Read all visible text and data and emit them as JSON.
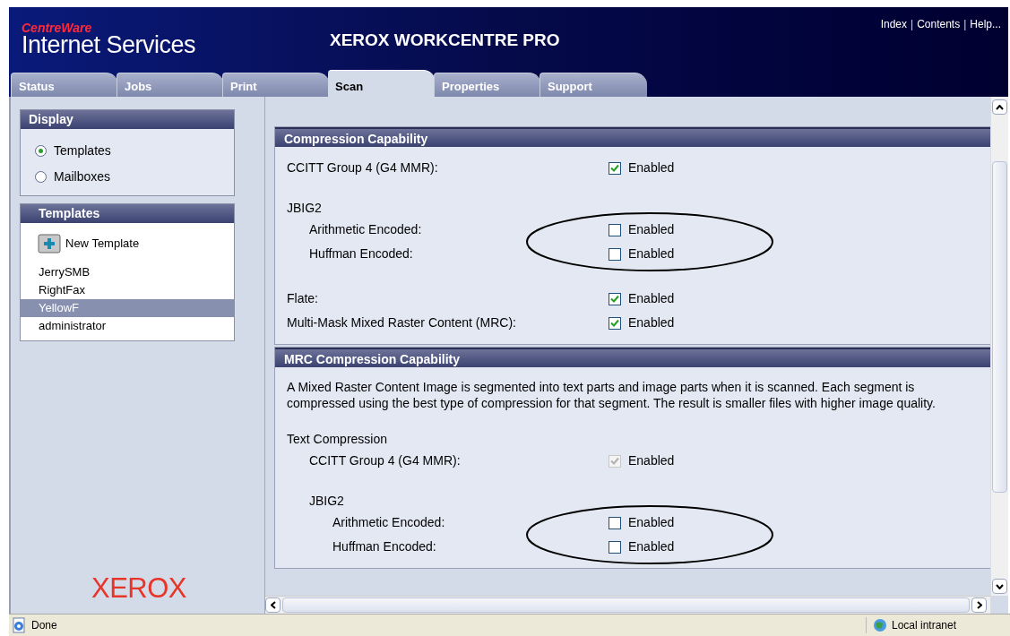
{
  "header": {
    "brand_top": "CentreWare",
    "brand": "Internet Services",
    "title": "XEROX WORKCENTRE PRO",
    "links": [
      {
        "kind": "link",
        "text": "Index"
      },
      {
        "kind": "separator",
        "text": "|"
      },
      {
        "kind": "link",
        "text": "Contents"
      },
      {
        "kind": "separator",
        "text": "|"
      },
      {
        "kind": "link",
        "text": "Help..."
      }
    ]
  },
  "tabs": [
    {
      "label": "Status",
      "selected": false
    },
    {
      "label": "Jobs",
      "selected": false
    },
    {
      "label": "Print",
      "selected": false
    },
    {
      "label": "Scan",
      "selected": true
    },
    {
      "label": "Properties",
      "selected": false
    },
    {
      "label": "Support",
      "selected": false
    }
  ],
  "sidebar": {
    "display": {
      "title": "Display",
      "options": [
        {
          "label": "Templates",
          "selected": true
        },
        {
          "label": "Mailboxes",
          "selected": false
        }
      ]
    },
    "templates": {
      "title": "Templates",
      "new_button": "New Template",
      "items": [
        {
          "label": "JerrySMB",
          "selected": false
        },
        {
          "label": "RightFax",
          "selected": false
        },
        {
          "label": "YellowF",
          "selected": true
        },
        {
          "label": "administrator",
          "selected": false
        }
      ]
    },
    "logo": "XEROX"
  },
  "sections": [
    {
      "title": "Compression Capability",
      "rows": [
        {
          "kind": "option",
          "label": "CCITT Group 4 (G4 MMR):",
          "checked": true,
          "disabled": false,
          "value_label": "Enabled"
        },
        {
          "kind": "group",
          "label": "JBIG2",
          "circled": true,
          "children": [
            {
              "kind": "option",
              "label": "Arithmetic Encoded:",
              "checked": false,
              "disabled": false,
              "value_label": "Enabled"
            },
            {
              "kind": "option",
              "label": "Huffman Encoded:",
              "checked": false,
              "disabled": false,
              "value_label": "Enabled"
            }
          ]
        },
        {
          "kind": "option",
          "label": "Flate:",
          "checked": true,
          "disabled": false,
          "value_label": "Enabled"
        },
        {
          "kind": "option",
          "label": "Multi-Mask Mixed Raster Content (MRC):",
          "checked": true,
          "disabled": false,
          "value_label": "Enabled"
        }
      ]
    },
    {
      "title": "MRC Compression Capability",
      "rows": [
        {
          "kind": "text",
          "text": "A Mixed Raster Content Image is segmented into text parts and image parts when it is scanned. Each segment is compressed using the best type of compression for that segment. The result is smaller files with higher image quality."
        },
        {
          "kind": "group",
          "label": "Text Compression",
          "children": [
            {
              "kind": "option",
              "label": "CCITT Group 4 (G4 MMR):",
              "checked": true,
              "disabled": true,
              "value_label": "Enabled"
            },
            {
              "kind": "group",
              "label": "JBIG2",
              "circled": true,
              "children": [
                {
                  "kind": "option",
                  "label": "Arithmetic Encoded:",
                  "checked": false,
                  "disabled": false,
                  "value_label": "Enabled"
                },
                {
                  "kind": "option",
                  "label": "Huffman Encoded:",
                  "checked": false,
                  "disabled": false,
                  "value_label": "Enabled"
                }
              ]
            }
          ]
        }
      ]
    }
  ],
  "status_bar": {
    "text": "Done",
    "zone": "Local intranet"
  }
}
